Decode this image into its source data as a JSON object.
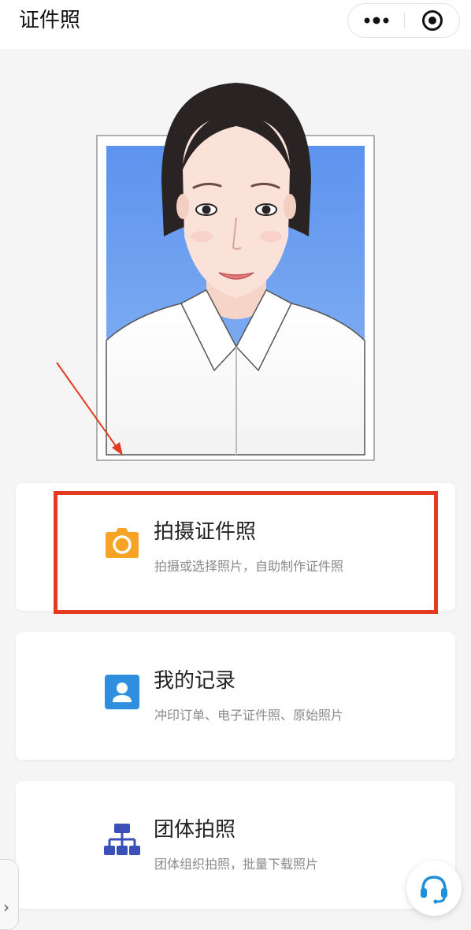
{
  "header": {
    "title": "证件照"
  },
  "cards": [
    {
      "title": "拍摄证件照",
      "subtitle": "拍摄或选择照片，自助制作证件照",
      "icon": "camera-icon",
      "color": "#f7a325"
    },
    {
      "title": "我的记录",
      "subtitle": "冲印订单、电子证件照、原始照片",
      "icon": "user-card-icon",
      "color": "#2f8fde"
    },
    {
      "title": "团体拍照",
      "subtitle": "团体组织拍照，批量下载照片",
      "icon": "group-org-icon",
      "color": "#3b4fb8"
    }
  ],
  "colors": {
    "photo_background": "#6a9ef2",
    "annotation_red": "#e33a22"
  }
}
